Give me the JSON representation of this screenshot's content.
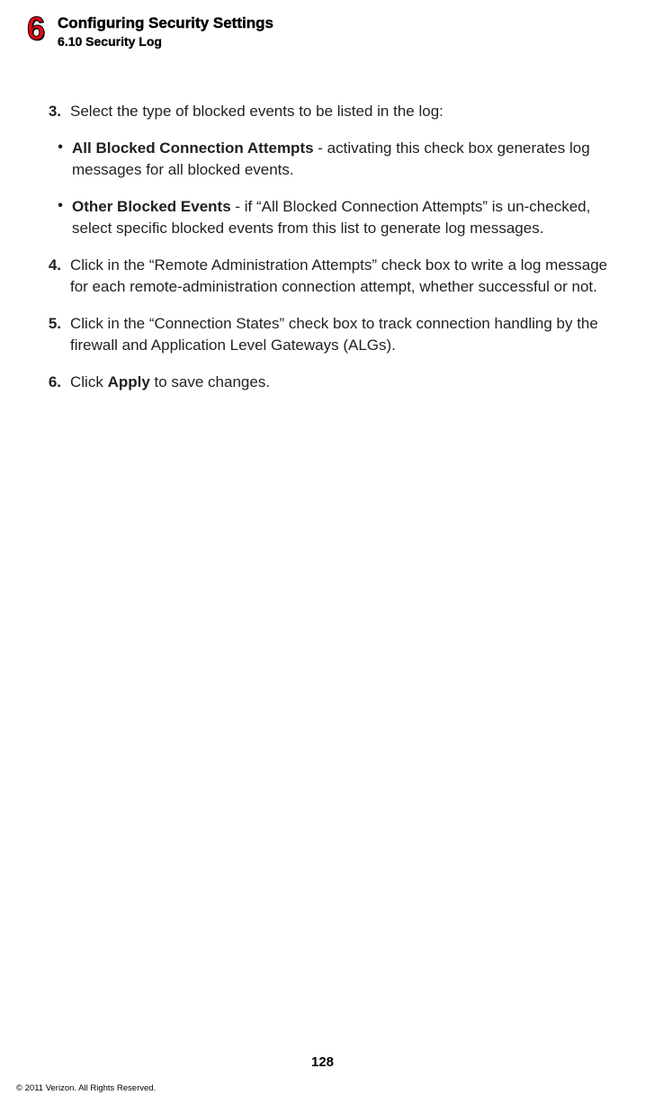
{
  "header": {
    "chapter_number": "6",
    "chapter_title": "Configuring Security Settings",
    "section_title": "6.10  Security Log"
  },
  "steps": {
    "s3": {
      "num": "3.",
      "text": "Select the type of blocked events to be listed in the log:"
    },
    "b1": {
      "dot": "•",
      "bold": "All Blocked Connection Attempts",
      "rest": " - activating this check box generates log messages for all blocked events."
    },
    "b2": {
      "dot": "•",
      "bold": "Other Blocked Events",
      "rest": " - if “All Blocked Connection Attempts” is un-checked, select specific blocked events from this list to generate log messages."
    },
    "s4": {
      "num": "4.",
      "text": "Click in the “Remote Administration Attempts” check box to write a log message for each remote-administration connection attempt, whether successful or not."
    },
    "s5": {
      "num": "5.",
      "text": "Click in the “Connection States” check box to track connection handling by the firewall and Application Level Gateways (ALGs)."
    },
    "s6": {
      "num": "6.",
      "pre": "Click ",
      "bold": "Apply",
      "post": " to save changes."
    }
  },
  "page_number": "128",
  "copyright": "© 2011 Verizon. All Rights Reserved."
}
